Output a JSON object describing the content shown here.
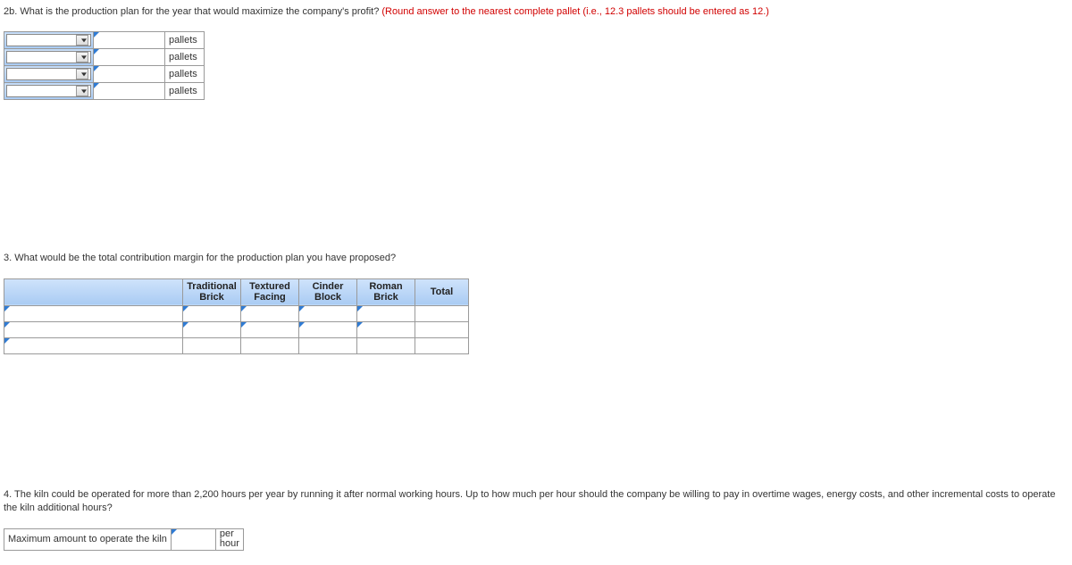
{
  "q2b": {
    "num": "2b.",
    "text": "What is the production plan for the year that would maximize the company's profit?",
    "hint": "(Round answer to the nearest complete pallet (i.e., 12.3 pallets should be entered as 12.)",
    "unit": "pallets"
  },
  "q3": {
    "num": "3.",
    "text": "What would be the total contribution margin for the production plan you have proposed?",
    "headers": {
      "traditional": "Traditional Brick",
      "textured": "Textured Facing",
      "cinder": "Cinder Block",
      "roman": "Roman Brick",
      "total": "Total"
    }
  },
  "q4": {
    "num": "4.",
    "text": "The kiln could be operated for more than 2,200 hours per year by running it after normal working hours. Up to how much per hour should the company be willing to pay in overtime wages, energy costs, and other incremental costs to operate the kiln additional hours?",
    "row_label": "Maximum amount to operate the kiln",
    "unit": "per hour"
  }
}
